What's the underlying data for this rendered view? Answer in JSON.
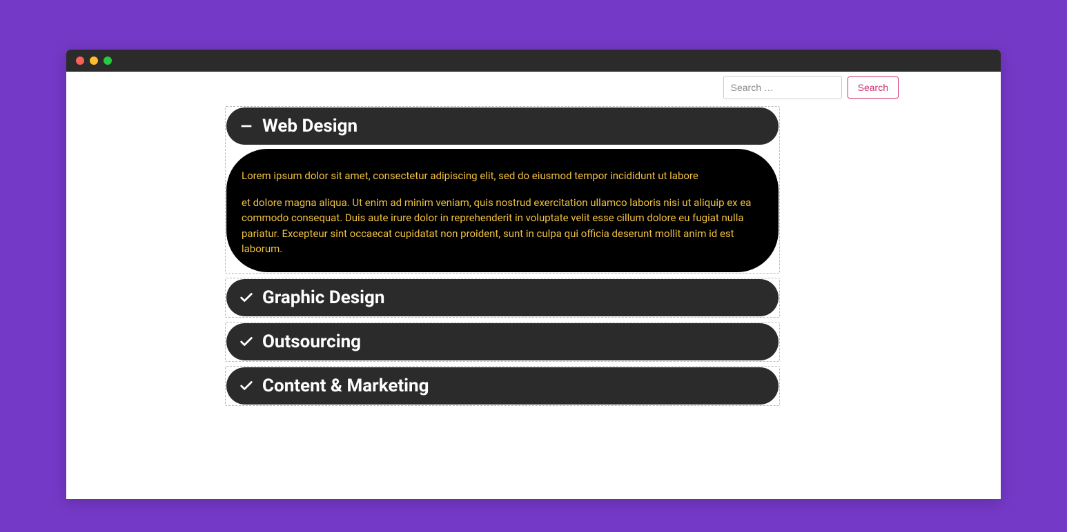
{
  "search": {
    "placeholder": "Search …",
    "button_label": "Search"
  },
  "accordion": {
    "items": [
      {
        "title": "Web Design",
        "expanded": true,
        "body_p1": "Lorem ipsum dolor sit amet, consectetur adipiscing elit, sed do eiusmod tempor incididunt ut labore",
        "body_p2": "et dolore magna aliqua. Ut enim ad minim veniam, quis nostrud exercitation ullamco laboris nisi ut aliquip ex ea commodo consequat. Duis aute irure dolor in reprehenderit in voluptate velit esse cillum dolore eu fugiat nulla pariatur. Excepteur sint occaecat cupidatat non proident, sunt in culpa qui officia deserunt mollit anim id est laborum."
      },
      {
        "title": "Graphic Design",
        "expanded": false
      },
      {
        "title": "Outsourcing",
        "expanded": false
      },
      {
        "title": "Content & Marketing",
        "expanded": false
      }
    ]
  }
}
